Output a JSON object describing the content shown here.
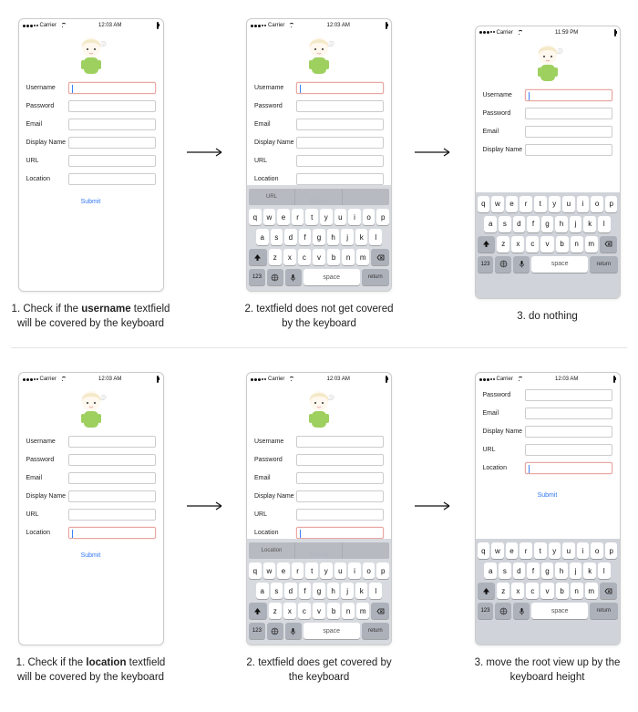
{
  "statusbar": {
    "carrier": "Carrier",
    "time_a": "12:03 AM",
    "time_b": "11:59 PM"
  },
  "form": {
    "username": "Username",
    "password": "Password",
    "email": "Email",
    "display_name": "Display Name",
    "url": "URL",
    "location": "Location",
    "submit": "Submit"
  },
  "keyboard": {
    "row1": [
      "q",
      "w",
      "e",
      "r",
      "t",
      "y",
      "u",
      "i",
      "o",
      "p"
    ],
    "row2": [
      "a",
      "s",
      "d",
      "f",
      "g",
      "h",
      "j",
      "k",
      "l"
    ],
    "row3": [
      "z",
      "x",
      "c",
      "v",
      "b",
      "n",
      "m"
    ],
    "num": "123",
    "space": "space",
    "return": "return",
    "predict_url": "URL",
    "predict_location": "Location"
  },
  "captions": {
    "r1c1_a": "1. Check if the ",
    "r1c1_bold": "username",
    "r1c1_b": " textfield will be covered by the keyboard",
    "r1c2": "2. textfield does not get covered by the keyboard",
    "r1c3": "3. do nothing",
    "r2c1_a": "1. Check if the ",
    "r2c1_bold": "location",
    "r2c1_b": " textfield will be covered by the keyboard",
    "r2c2": "2. textfield does get covered by the keyboard",
    "r2c3": "3. move the root view up by the keyboard height"
  }
}
